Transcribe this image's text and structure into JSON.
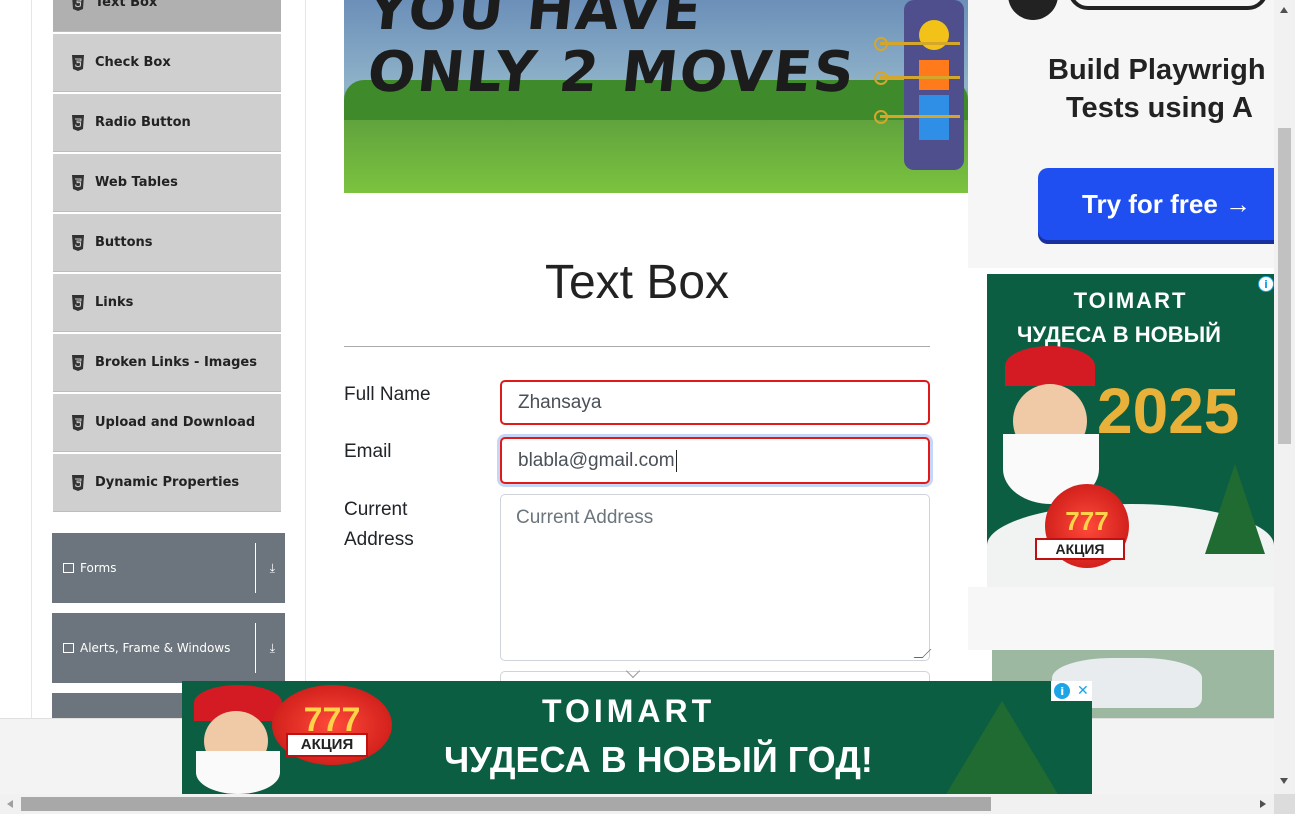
{
  "sidebar": {
    "items": [
      {
        "label": "Text Box",
        "active": true
      },
      {
        "label": "Check Box"
      },
      {
        "label": "Radio Button"
      },
      {
        "label": "Web Tables"
      },
      {
        "label": "Buttons"
      },
      {
        "label": "Links"
      },
      {
        "label": "Broken Links - Images"
      },
      {
        "label": "Upload and Download"
      },
      {
        "label": "Dynamic Properties"
      }
    ],
    "item_icon": "html5-icon",
    "groups": [
      {
        "label": "Forms",
        "icon": "form-icon"
      },
      {
        "label": "Alerts, Frame & Windows",
        "icon": "window-icon"
      }
    ]
  },
  "banner": {
    "line1": "YOU HAVE",
    "line2": "ONLY 2 MOVES"
  },
  "main": {
    "title": "Text Box",
    "form": {
      "full_name_label": "Full Name",
      "full_name_value": "Zhansaya",
      "email_label": "Email",
      "email_value": "blabla@gmail.com",
      "address_label_1": "Current",
      "address_label_2": "Address",
      "address_placeholder": "Current Address"
    }
  },
  "ads": {
    "right_top": {
      "headline_1": "Build Playwrigh",
      "headline_2": "Tests using A",
      "cta": "Try for free →"
    },
    "right_mid": {
      "brand": "TOIMART",
      "promo": "ЧУДЕСА В НОВЫЙ ГОД!",
      "year": "2025",
      "badge_num": "777",
      "badge_text": "АКЦИЯ"
    },
    "bottom": {
      "brand": "TOIMART",
      "promo": "ЧУДЕСА В НОВЫЙ ГОД!",
      "badge_num": "777",
      "badge_text": "АКЦИЯ"
    },
    "info_glyph": "i",
    "close_glyph": "✕"
  },
  "colors": {
    "sidebar_item_bg": "#cfcfcf",
    "group_bg": "#6c757d",
    "invalid_border": "#e01a1a",
    "cta_blue": "#1f4ff0",
    "ad_green": "#0c5e43"
  }
}
